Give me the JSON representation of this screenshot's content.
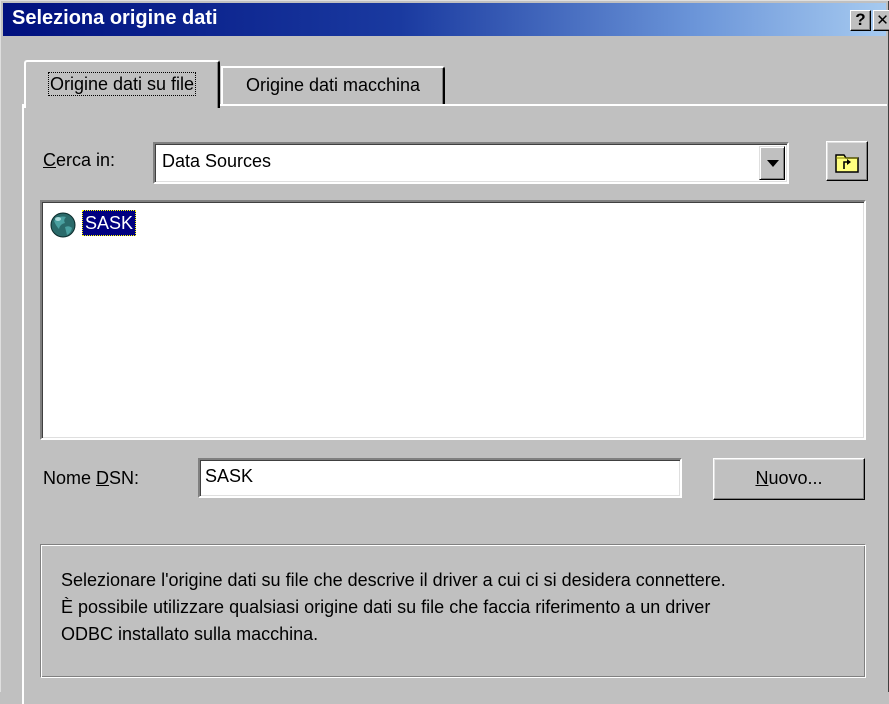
{
  "window": {
    "title": "Seleziona origine dati",
    "help_glyph": "?",
    "close_glyph": "✕"
  },
  "tabs": [
    {
      "label": "Origine dati su file",
      "active": true
    },
    {
      "label": "Origine dati macchina",
      "active": false
    }
  ],
  "lookin": {
    "label_prefix": "",
    "label_accel": "C",
    "label_rest": "erca in:",
    "value": "Data Sources"
  },
  "files": [
    {
      "name": "SASK",
      "icon": "globe-dsn-icon",
      "selected": true
    }
  ],
  "dsn": {
    "label_prefix": "Nome ",
    "label_accel": "D",
    "label_rest": "SN:",
    "value": "SASK"
  },
  "buttons": {
    "new_accel": "N",
    "new_rest": "uovo..."
  },
  "description": "Selezionare l'origine dati su file che descrive il driver a cui ci si desidera connettere.\nÈ possibile utilizzare qualsiasi origine dati su file che faccia riferimento a un driver\nODBC installato sulla macchina.",
  "colors": {
    "titlebar_start": "#00107e",
    "titlebar_end": "#a6caf0",
    "face": "#c0c0c0",
    "selection": "#000080"
  }
}
